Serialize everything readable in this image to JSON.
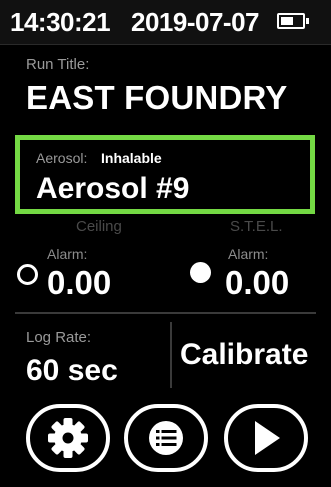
{
  "status": {
    "time": "14:30:21",
    "date": "2019-07-07",
    "battery_level": 0.6
  },
  "run": {
    "label": "Run Title:",
    "value": "EAST FOUNDRY"
  },
  "aerosol": {
    "label": "Aerosol:",
    "type": "Inhalable",
    "name": "Aerosol #9",
    "highlight_color": "#74d944"
  },
  "alarms": [
    {
      "caption": "Ceiling",
      "label": "Alarm:",
      "value": "0.00",
      "indicator": "hollow"
    },
    {
      "caption": "S.T.E.L.",
      "label": "Alarm:",
      "value": "0.00",
      "indicator": "filled"
    }
  ],
  "log_rate": {
    "label": "Log Rate:",
    "value": "60 sec"
  },
  "calibrate_label": "Calibrate",
  "buttons": [
    {
      "icon": "gear-icon"
    },
    {
      "icon": "list-icon"
    },
    {
      "icon": "play-icon"
    }
  ]
}
